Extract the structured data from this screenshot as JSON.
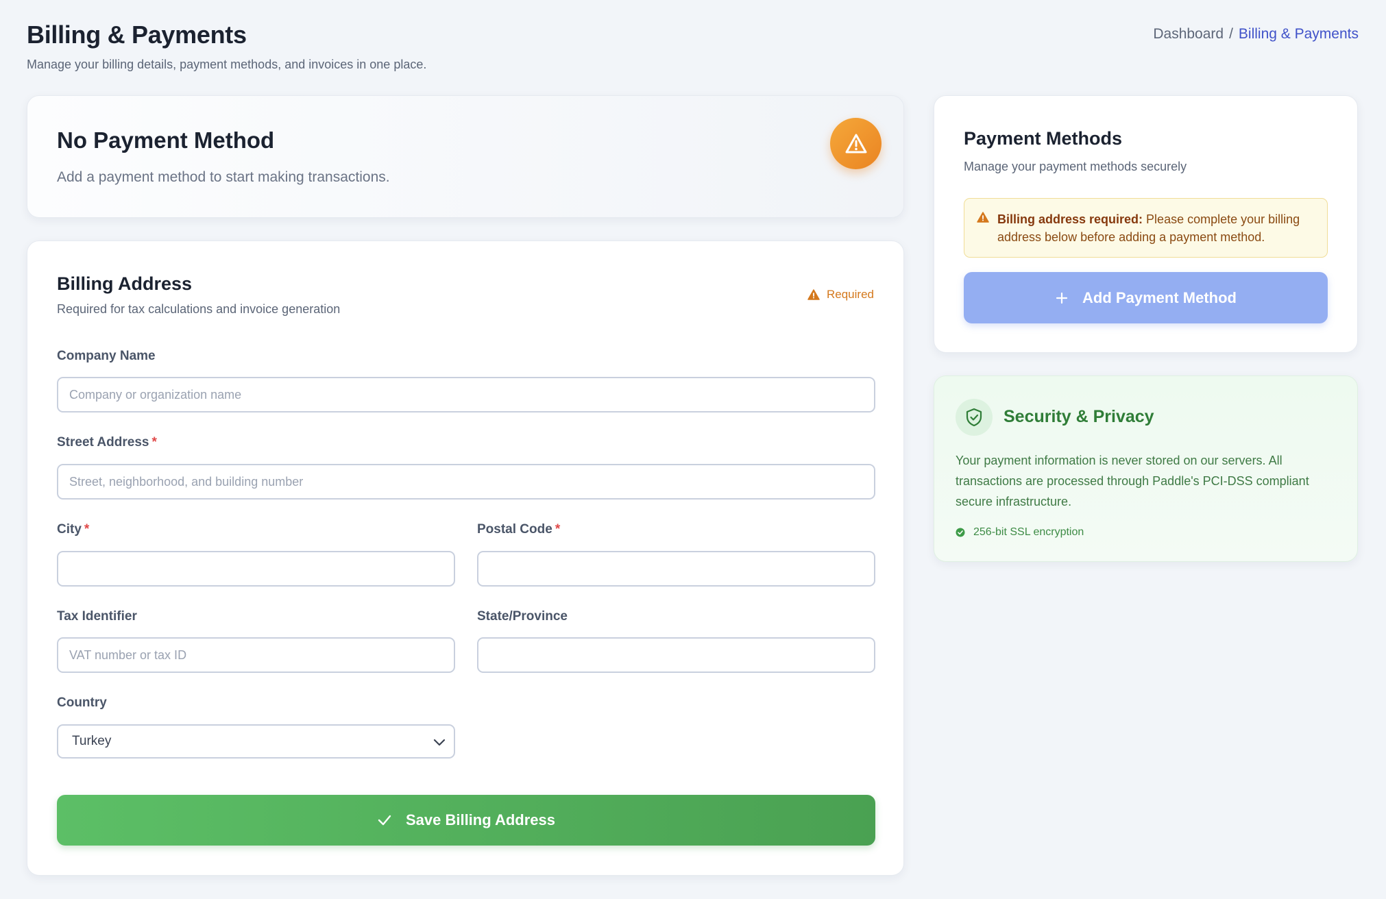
{
  "header": {
    "title": "Billing & Payments",
    "subtitle": "Manage your billing details, payment methods, and invoices in one place."
  },
  "breadcrumb": {
    "parent": "Dashboard",
    "separator": "/",
    "current": "Billing & Payments"
  },
  "no_payment": {
    "title": "No Payment Method",
    "description": "Add a payment method to start making transactions.",
    "icon": "warning-icon"
  },
  "billing_address": {
    "title": "Billing Address",
    "subtitle": "Required for tax calculations and invoice generation",
    "required_badge": "Required",
    "fields": {
      "company": {
        "label": "Company Name",
        "placeholder": "Company or organization name",
        "value": ""
      },
      "street": {
        "label": "Street Address",
        "required_mark": "*",
        "placeholder": "Street, neighborhood, and building number",
        "value": ""
      },
      "city": {
        "label": "City",
        "required_mark": "*",
        "placeholder": "",
        "value": ""
      },
      "postal": {
        "label": "Postal Code",
        "required_mark": "*",
        "placeholder": "",
        "value": ""
      },
      "tax": {
        "label": "Tax Identifier",
        "placeholder": "VAT number or tax ID",
        "value": ""
      },
      "state": {
        "label": "State/Province",
        "placeholder": "",
        "value": ""
      },
      "country": {
        "label": "Country",
        "selected": "Turkey"
      }
    },
    "save_button": "Save Billing Address"
  },
  "payment_methods": {
    "title": "Payment Methods",
    "subtitle": "Manage your payment methods securely",
    "alert_strong": "Billing address required:",
    "alert_text": " Please complete your billing address below before adding a payment method.",
    "add_button": "Add Payment Method"
  },
  "security": {
    "title": "Security & Privacy",
    "description": "Your payment information is never stored on our servers. All transactions are processed through Paddle's PCI-DSS compliant secure infrastructure.",
    "badge": "256-bit SSL encryption"
  },
  "colors": {
    "accent_blue": "#4052c9",
    "warning_orange": "#ea8422",
    "success_green": "#4aa152",
    "disabled_button_blue": "#94aef2"
  }
}
